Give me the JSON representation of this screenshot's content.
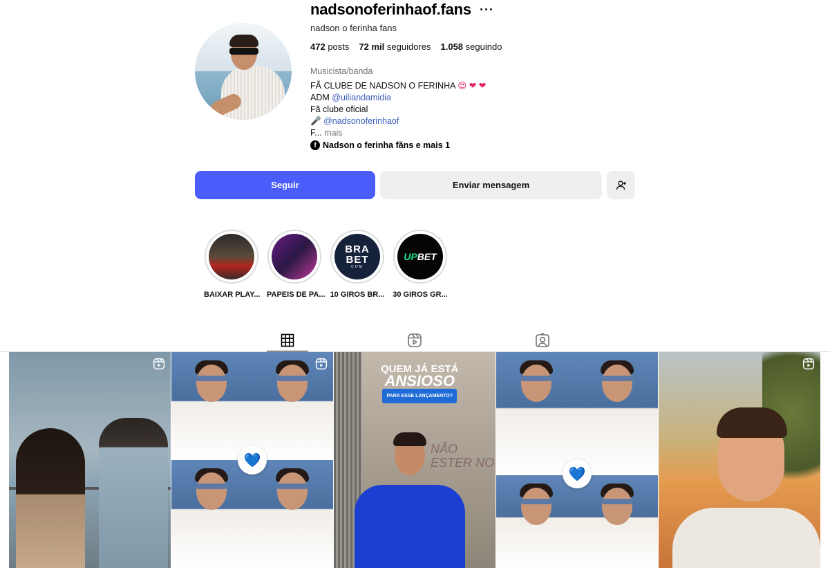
{
  "profile": {
    "username": "nadsonoferinhaof.fans",
    "more": "···",
    "full_name": "nadson o ferinha fans",
    "stats": {
      "posts_count": "472",
      "posts_label": "posts",
      "followers_count": "72 mil",
      "followers_label": "seguidores",
      "following_count": "1.058",
      "following_label": "seguindo"
    },
    "category": "Musicista/banda",
    "bio": {
      "line1": "FÃ CLUBE DE NADSON O FERINHA",
      "line1_emojis": "😍 ❤ ❤",
      "line2_prefix": "ADM",
      "line2_mention": "@uiliandamidia",
      "line3": "Fã clube oficial",
      "line4_icon": "🎤",
      "line4_mention": "@nadsonoferinhaof",
      "line5_truncated": "F...",
      "line5_more": "mais"
    },
    "facebook_link": "Nadson o ferinha fãns e mais 1"
  },
  "actions": {
    "follow_label": "Seguir",
    "message_label": "Enviar mensagem"
  },
  "highlights": [
    {
      "label": "BAIXAR PLAY..."
    },
    {
      "label": "PAPEIS DE PA..."
    },
    {
      "label": "10 GIROS BR...",
      "logo_top": "BRA",
      "logo_bottom": "BET",
      "logo_sub": "COM"
    },
    {
      "label": "30 GIROS GR...",
      "logo_up": "UP",
      "logo_bet": "BET"
    }
  ],
  "tabs": [
    {
      "name": "posts",
      "icon": "grid-icon",
      "active": true
    },
    {
      "name": "reels",
      "icon": "reels-icon",
      "active": false
    },
    {
      "name": "tagged",
      "icon": "tagged-icon",
      "active": false
    }
  ],
  "posts": {
    "post3_caption_line1": "QUEM JÁ ESTÁ",
    "post3_caption_line2": "ANSIOSO",
    "post3_caption_pill": "PARA ESSE LANÇAMENTO?",
    "post3_graffiti": "NÃO ESTER NO"
  },
  "colors": {
    "follow_button": "#4a5dfb",
    "secondary_button": "#efefef",
    "link": "#3c5ebe",
    "muted": "#737373"
  }
}
